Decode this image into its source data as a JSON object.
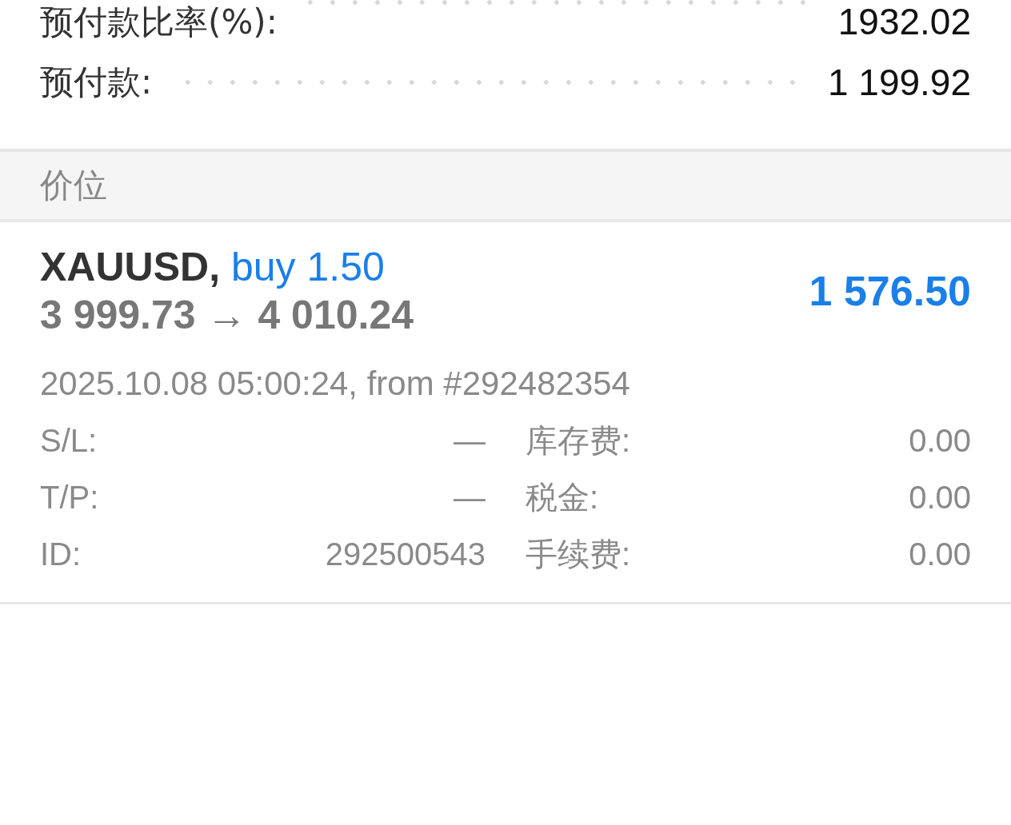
{
  "account_rows": [
    {
      "label": "预付款比率(%):",
      "value": "1932.02"
    },
    {
      "label": "预付款:",
      "value": "1 199.92"
    }
  ],
  "section": {
    "title": "价位"
  },
  "position": {
    "symbol": "XAUUSD,",
    "side": "buy 1.50",
    "prices": "3 999.73 → 4 010.24",
    "profit": "1 576.50",
    "opened": "2025.10.08 05:00:24, from #292482354",
    "details": [
      {
        "label": "S/L:",
        "value": "—",
        "label2": "库存费:",
        "value2": "0.00"
      },
      {
        "label": "T/P:",
        "value": "—",
        "label2": "税金:",
        "value2": "0.00"
      },
      {
        "label": "ID:",
        "value": "292500543",
        "label2": "手续费:",
        "value2": "0.00"
      }
    ]
  }
}
